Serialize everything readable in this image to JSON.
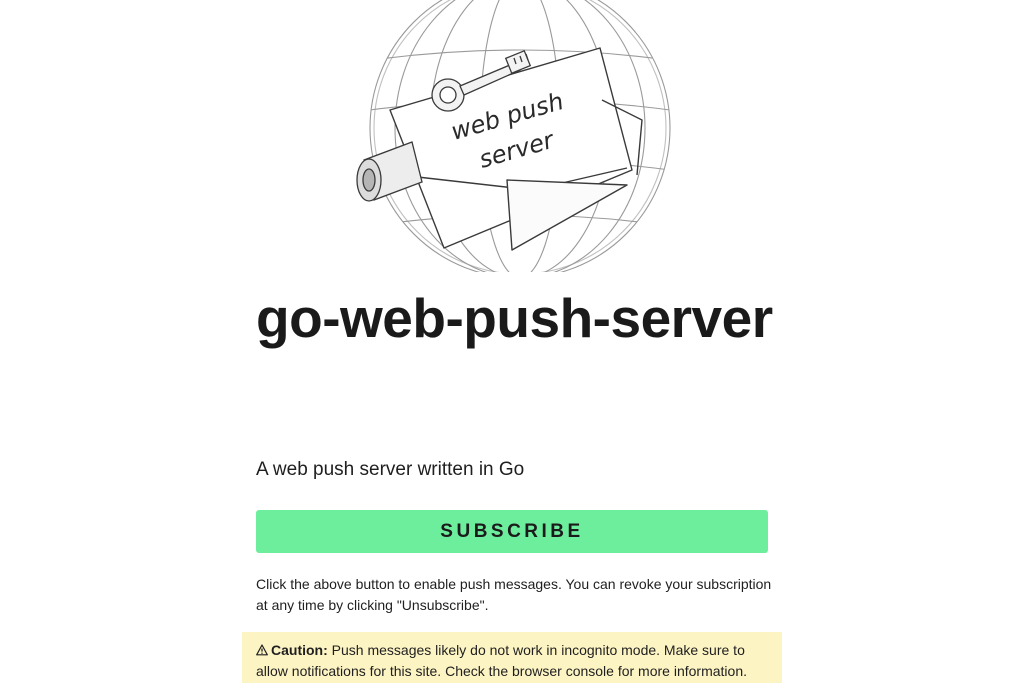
{
  "hero": {
    "logo_text_line1": "web push",
    "logo_text_line2": "server",
    "logo_description": "sketch of a globe with an envelope and a key"
  },
  "title": "go-web-push-server",
  "tagline": "A web push server written in Go",
  "subscribe_button": {
    "label": "SUBSCRIBE",
    "color": "#6cee9d"
  },
  "help_text": "Click the above button to enable push messages. You can revoke your subscription at any time by clicking \"Unsubscribe\".",
  "caution": {
    "icon": "warning-icon",
    "label": "Caution:",
    "text": " Push messages likely do not work in incognito mode. Make sure to allow notifications for this site. Check the browser console for more information.",
    "background": "#fdf4c4"
  }
}
